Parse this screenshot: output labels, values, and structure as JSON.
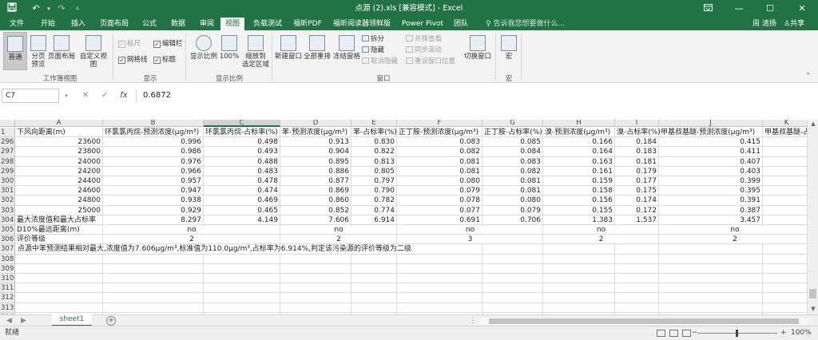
{
  "title_bar": {
    "save_icon": "save-icon",
    "undo_icon": "undo-icon",
    "redo_icon": "redo-icon",
    "customize_icon": "customize-quick-access-icon",
    "document_title": "点源 (2).xls  [兼容模式]  -  Excel"
  },
  "tabs": {
    "items": [
      "文件",
      "开始",
      "插入",
      "页面布局",
      "公式",
      "数据",
      "审阅",
      "视图",
      "负载测试",
      "福昕PDF",
      "福昕阅读器领鲜版",
      "Power Pivot",
      "团队"
    ],
    "active": "视图",
    "tell_me": "告诉我您想要做什么...",
    "user": "周 清扬",
    "share": "共享"
  },
  "ribbon": {
    "workbook_views": {
      "group": "工作簿视图",
      "normal": "普通",
      "page_break": "分页\n预览",
      "page_layout": "页面布局",
      "custom_views": "自定义视图"
    },
    "show": {
      "group": "显示",
      "ruler": "标尺",
      "gridlines": "网格线",
      "formula_bar": "编辑栏",
      "headings": "标题"
    },
    "zoom": {
      "group": "显示比例",
      "zoom": "显示比例",
      "hundred": "100%",
      "zoom_selection": "缩放到\n选定区域"
    },
    "window": {
      "group": "窗口",
      "new_window": "新建窗口",
      "arrange_all": "全部重排",
      "freeze_panes": "冻结窗格",
      "split": "拆分",
      "hide": "隐藏",
      "unhide": "取消隐藏",
      "view_side_by_side": "并排查看",
      "sync_scroll": "同步滚动",
      "reset_position": "重设窗口位置",
      "switch_windows": "切换窗口"
    },
    "macros": {
      "group": "宏",
      "macros": "宏"
    }
  },
  "formula_bar": {
    "name_box": "C7",
    "cancel_icon": "cancel-icon",
    "enter_icon": "enter-icon",
    "fx": "fx",
    "value": "0.6872"
  },
  "grid": {
    "columns": [
      "A",
      "B",
      "C",
      "D",
      "E",
      "F",
      "G",
      "H",
      "I",
      "J",
      "K"
    ],
    "selected_column": "C",
    "row_numbers": [
      "1",
      "296",
      "297",
      "298",
      "299",
      "300",
      "301",
      "302",
      "303",
      "304",
      "305",
      "306",
      "307",
      "308",
      "309",
      "310",
      "311",
      "312",
      "313",
      "314"
    ],
    "header_row": [
      "下风向距离(m)",
      "环氯氯丙烷-预测浓度(μg/m³)",
      "环氯氯丙烷-占标率(%)",
      "苯-预测浓度(μg/m³)",
      "苯-占标率(%)",
      "正丁胺-预测浓度(μg/m³)",
      "正丁胺-占标率(%)",
      "溴-预测浓度(μg/m³)",
      "溴-占标率(%)",
      "甲基叔基醚-预测浓度(μg/m³)",
      "甲基叔基醚-占"
    ],
    "data_rows": [
      [
        "23600",
        "0.996",
        "0.498",
        "0.913",
        "0.830",
        "0.083",
        "0.085",
        "0.166",
        "0.184",
        "0.415",
        ""
      ],
      [
        "23800",
        "0.986",
        "0.493",
        "0.904",
        "0.822",
        "0.082",
        "0.084",
        "0.164",
        "0.183",
        "0.411",
        ""
      ],
      [
        "24000",
        "0.976",
        "0.488",
        "0.895",
        "0.813",
        "0.081",
        "0.083",
        "0.163",
        "0.181",
        "0.407",
        ""
      ],
      [
        "24200",
        "0.966",
        "0.483",
        "0.886",
        "0.805",
        "0.081",
        "0.082",
        "0.161",
        "0.179",
        "0.403",
        ""
      ],
      [
        "24400",
        "0.957",
        "0.478",
        "0.877",
        "0.797",
        "0.080",
        "0.081",
        "0.159",
        "0.177",
        "0.399",
        ""
      ],
      [
        "24600",
        "0.947",
        "0.474",
        "0.869",
        "0.790",
        "0.079",
        "0.081",
        "0.158",
        "0.175",
        "0.395",
        ""
      ],
      [
        "24800",
        "0.938",
        "0.469",
        "0.860",
        "0.782",
        "0.078",
        "0.080",
        "0.156",
        "0.174",
        "0.391",
        ""
      ],
      [
        "25000",
        "0.929",
        "0.465",
        "0.852",
        "0.774",
        "0.077",
        "0.079",
        "0.155",
        "0.172",
        "0.387",
        ""
      ]
    ],
    "row_304": {
      "label": "最大浓度值和最大占标率",
      "values": [
        "8.297",
        "4.149",
        "7.606",
        "6.914",
        "0.691",
        "0.706",
        "1.383",
        "1.537",
        "3.457"
      ]
    },
    "row_305": {
      "label": "D10%最远距离(m)",
      "values": [
        "no",
        "no",
        "no",
        "no",
        "no"
      ]
    },
    "row_306": {
      "label": "评价等级",
      "values": [
        "2",
        "2",
        "3",
        "2",
        "2"
      ]
    },
    "row_307": {
      "text": "点源中苯预测结果相对最大,浓度值为7.606μg/m³,标准值为110.0μg/m³,占标率为6.914%,判定该污染源的评价等级为二级"
    }
  },
  "sheets": {
    "items": [
      "sheet1"
    ],
    "active": "sheet1"
  },
  "status": {
    "text": "就绪",
    "zoom": "100%"
  },
  "colors": {
    "brand": "#217346",
    "ribbon_bg": "#f3f3f3",
    "header_bg": "#ebebeb"
  }
}
